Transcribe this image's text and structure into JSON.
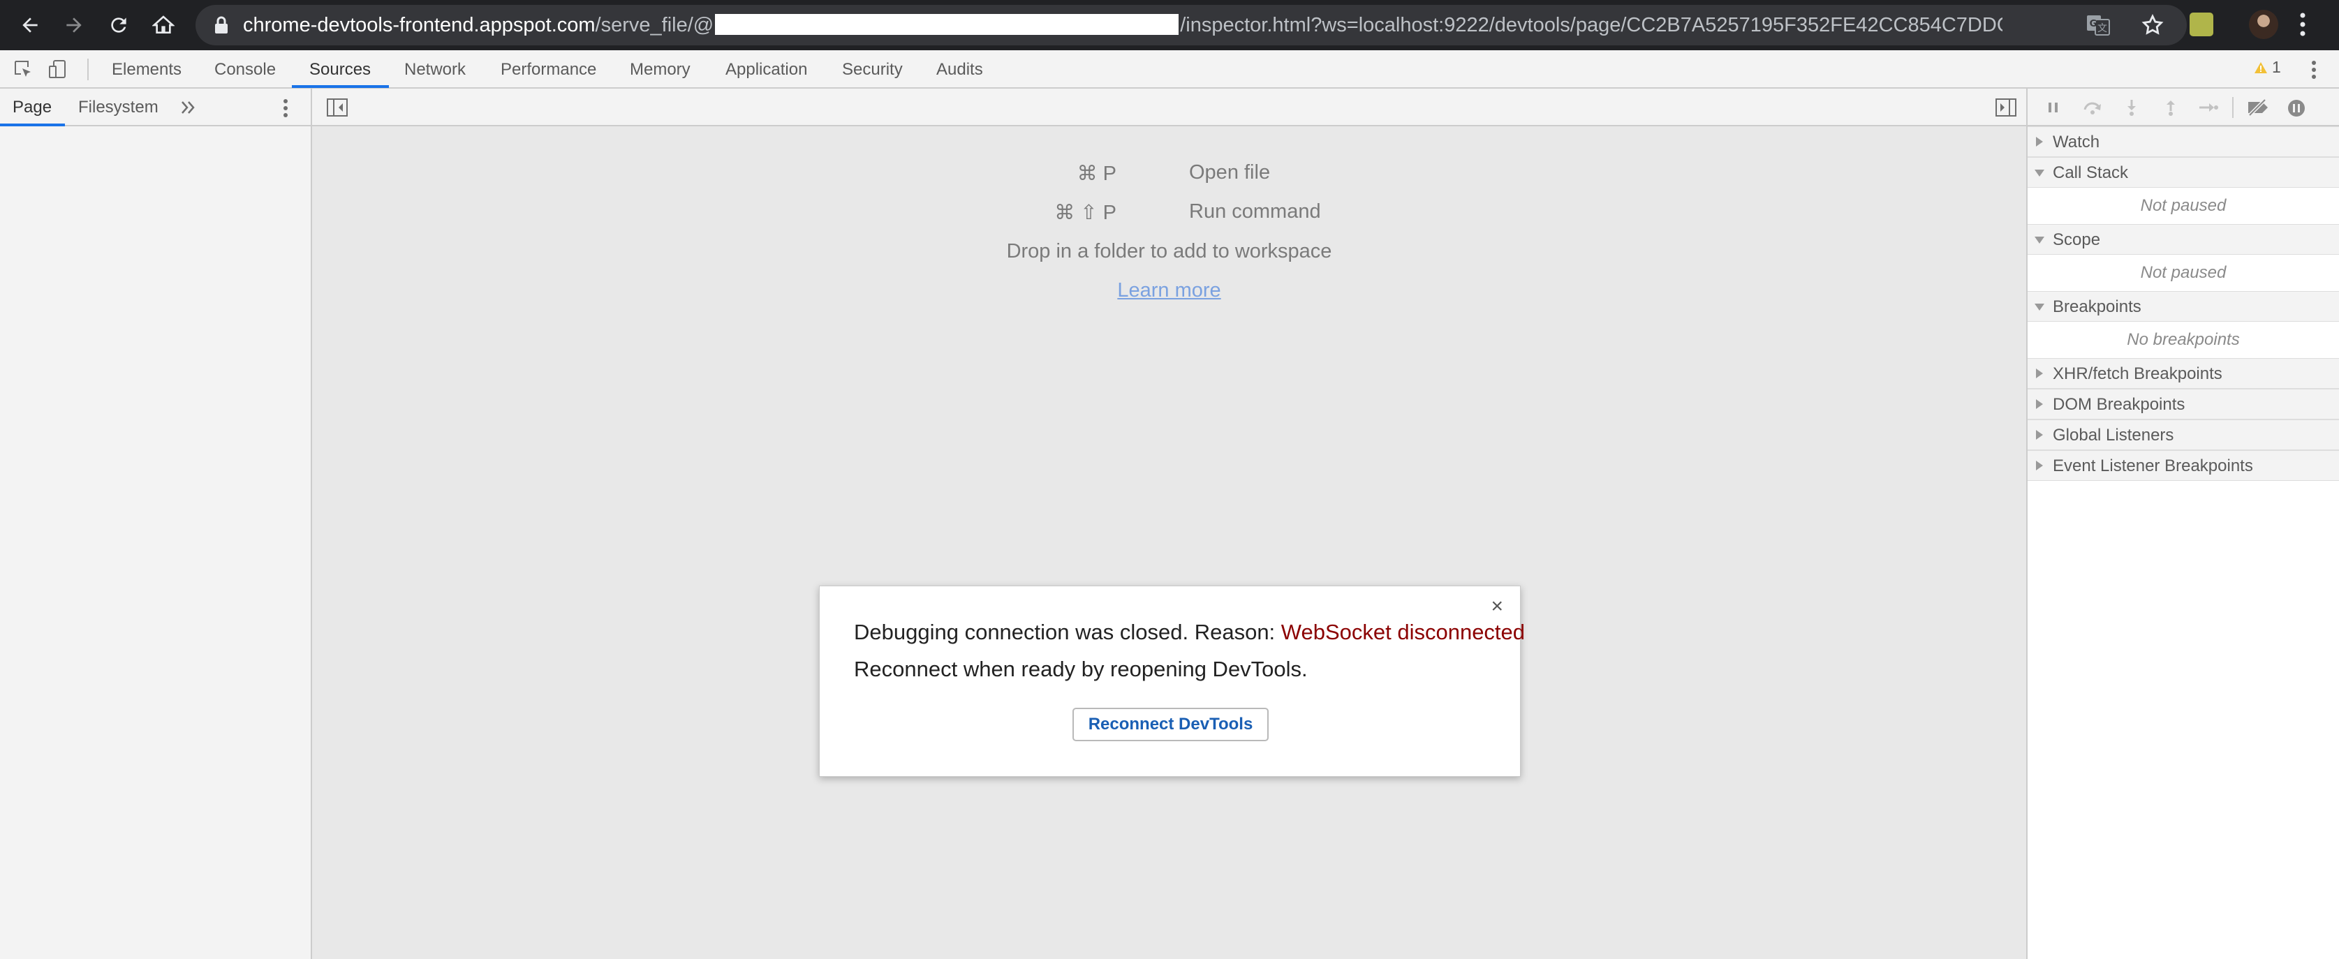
{
  "browser": {
    "url_host": "chrome-devtools-frontend.appspot.com",
    "url_prefix": "/serve_file/@",
    "url_suffix": "/inspector.html?ws=localhost:9222/devtools/page/CC2B7A5257195F352FE42CC854C7DDC..."
  },
  "devtools": {
    "tabs": [
      "Elements",
      "Console",
      "Sources",
      "Network",
      "Performance",
      "Memory",
      "Application",
      "Security",
      "Audits"
    ],
    "active_tab": "Sources",
    "warning_count": "1"
  },
  "navigator": {
    "tabs": [
      "Page",
      "Filesystem"
    ],
    "active_tab": "Page"
  },
  "editor": {
    "shortcuts": [
      {
        "keys": "⌘ P",
        "label": "Open file"
      },
      {
        "keys": "⌘ ⇧ P",
        "label": "Run command"
      }
    ],
    "drop_text": "Drop in a folder to add to workspace",
    "learn_more": "Learn more"
  },
  "dialog": {
    "close": "×",
    "message_prefix": "Debugging connection was closed. Reason: ",
    "reason": "WebSocket disconnected",
    "message_line2": "Reconnect when ready by reopening DevTools.",
    "button": "Reconnect DevTools"
  },
  "sidebar": {
    "sections": [
      {
        "label": "Watch",
        "expanded": false
      },
      {
        "label": "Call Stack",
        "expanded": true,
        "empty": "Not paused"
      },
      {
        "label": "Scope",
        "expanded": true,
        "empty": "Not paused"
      },
      {
        "label": "Breakpoints",
        "expanded": true,
        "empty": "No breakpoints"
      },
      {
        "label": "XHR/fetch Breakpoints",
        "expanded": false
      },
      {
        "label": "DOM Breakpoints",
        "expanded": false
      },
      {
        "label": "Global Listeners",
        "expanded": false
      },
      {
        "label": "Event Listener Breakpoints",
        "expanded": false
      }
    ]
  },
  "colors": {
    "accent": "#1a73e8",
    "error_reason": "#8b0000",
    "link": "#7aa1e0"
  }
}
